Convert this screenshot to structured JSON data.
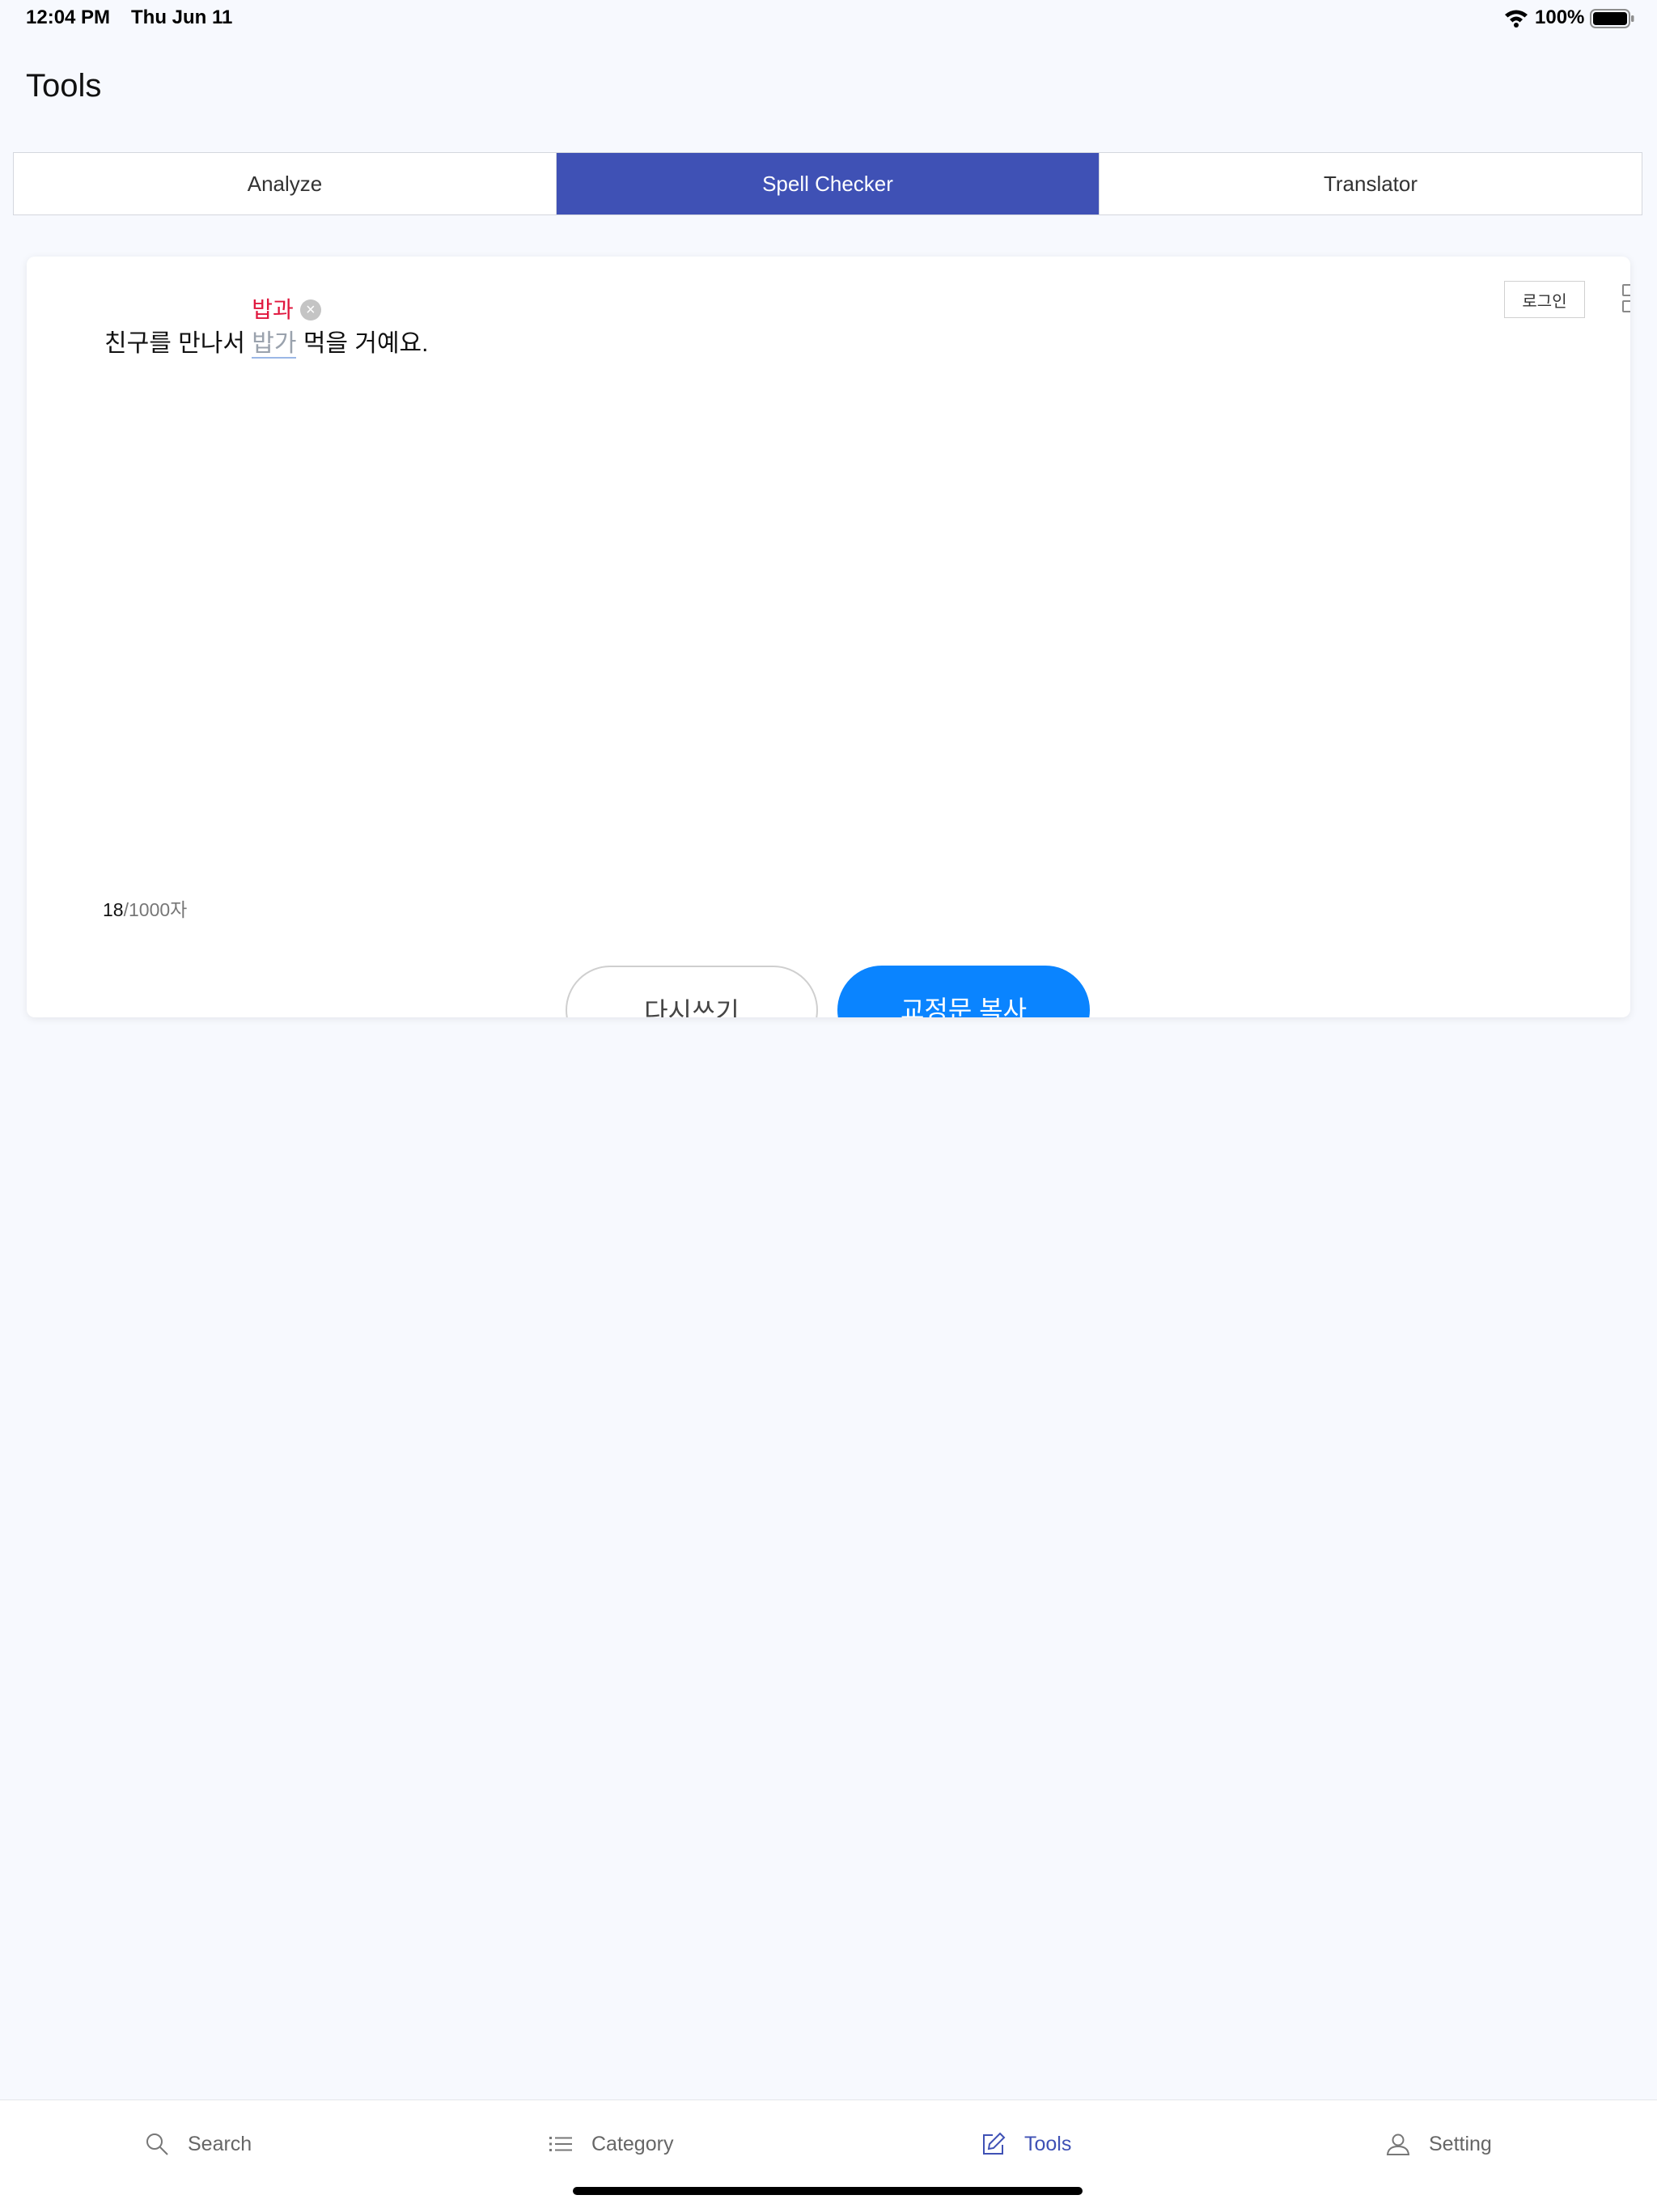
{
  "status_bar": {
    "time": "12:04 PM",
    "date": "Thu Jun 11",
    "battery": "100%"
  },
  "page_title": "Tools",
  "tabs": [
    {
      "label": "Analyze",
      "active": false
    },
    {
      "label": "Spell Checker",
      "active": true
    },
    {
      "label": "Translator",
      "active": false
    }
  ],
  "spell_checker": {
    "login_label": "로그인",
    "text_before": "친구를 만나서 ",
    "error_word": "밥가",
    "text_after": " 먹을 거예요.",
    "suggestion": "밥과",
    "char_count": "18",
    "char_limit": "/1000자",
    "rewrite_label": "다시쓰기",
    "copy_label": "교정문 복사"
  },
  "bottom_tabs": [
    {
      "label": "Search",
      "icon": "search-icon"
    },
    {
      "label": "Category",
      "icon": "list-icon"
    },
    {
      "label": "Tools",
      "icon": "edit-icon",
      "active": true
    },
    {
      "label": "Setting",
      "icon": "person-icon"
    }
  ],
  "colors": {
    "accent": "#3f51b5",
    "error": "#e0173e",
    "primary_button": "#0a84ff"
  }
}
